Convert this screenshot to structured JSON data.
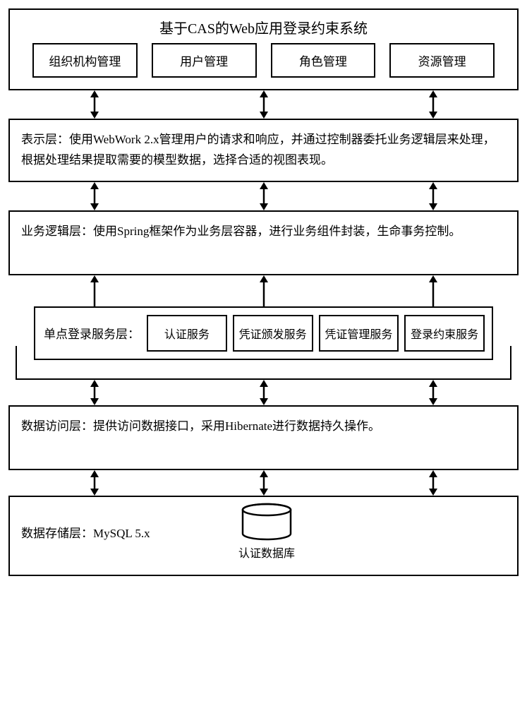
{
  "title": "基于CAS的Web应用登录约束系统",
  "top_modules": [
    "组织机构管理",
    "用户管理",
    "角色管理",
    "资源管理"
  ],
  "presentation_layer": "表示层：使用WebWork 2.x管理用户的请求和响应，并通过控制器委托业务逻辑层来处理，根据处理结果提取需要的模型数据，选择合适的视图表现。",
  "business_layer": "业务逻辑层：使用Spring框架作为业务层容器，进行业务组件封装，生命事务控制。",
  "sso_layer": {
    "label": "单点登录服务层：",
    "items": [
      "认证服务",
      "凭证颁发服务",
      "凭证管理服务",
      "登录约束服务"
    ]
  },
  "data_access_layer": "数据访问层：提供访问数据接口，采用Hibernate进行数据持久操作。",
  "data_store_layer": "数据存储层：MySQL 5.x",
  "db_label": "认证数据库"
}
